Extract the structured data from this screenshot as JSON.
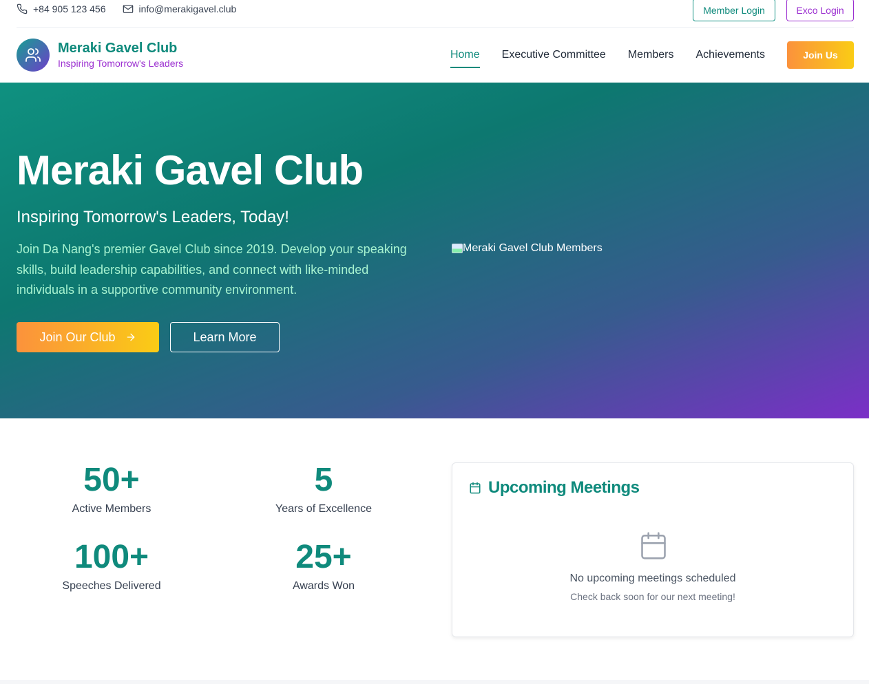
{
  "topbar": {
    "phone": "+84 905 123 456",
    "email": "info@merakigavel.club",
    "member_login": "Member Login",
    "exco_login": "Exco Login"
  },
  "brand": {
    "name": "Meraki Gavel Club",
    "tagline": "Inspiring Tomorrow's Leaders"
  },
  "nav": {
    "items": [
      {
        "label": "Home",
        "active": true
      },
      {
        "label": "Executive Committee",
        "active": false
      },
      {
        "label": "Members",
        "active": false
      },
      {
        "label": "Achievements",
        "active": false
      }
    ],
    "join": "Join Us"
  },
  "hero": {
    "title": "Meraki Gavel Club",
    "subtitle": "Inspiring Tomorrow's Leaders, Today!",
    "description": "Join Da Nang's premier Gavel Club since 2019. Develop your speaking skills, build leadership capabilities, and connect with like-minded individuals in a supportive community environment.",
    "join_button": "Join Our Club",
    "learn_button": "Learn More",
    "image_alt": "Meraki Gavel Club Members"
  },
  "stats": [
    {
      "value": "50+",
      "label": "Active Members"
    },
    {
      "value": "5",
      "label": "Years of Excellence"
    },
    {
      "value": "100+",
      "label": "Speeches Delivered"
    },
    {
      "value": "25+",
      "label": "Awards Won"
    }
  ],
  "meetings": {
    "title": "Upcoming Meetings",
    "empty_title": "No upcoming meetings scheduled",
    "empty_subtitle": "Check back soon for our next meeting!"
  },
  "colors": {
    "primary": "#0f8a7c",
    "accent": "#9b2fd0",
    "cta_start": "#fb923c",
    "cta_end": "#facc15"
  }
}
